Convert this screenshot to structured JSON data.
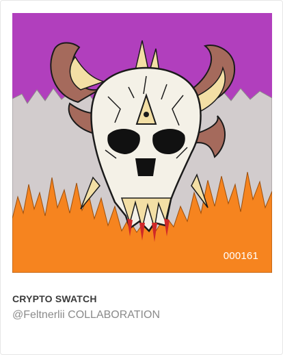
{
  "card": {
    "token_id": "000161",
    "title": "CRYPTO SWATCH",
    "creator": "@Feltnerlii",
    "collaboration_label": "COLLABORATION"
  },
  "artwork": {
    "subject": "horned-skull",
    "colors": {
      "sky": "#b13fbd",
      "smoke": "#d2cccd",
      "flames": "#f6841f",
      "skull": "#f4f1e7",
      "horn_outer": "#a56a5c",
      "horn_inner": "#f3dfa5",
      "blood": "#d02828"
    }
  }
}
